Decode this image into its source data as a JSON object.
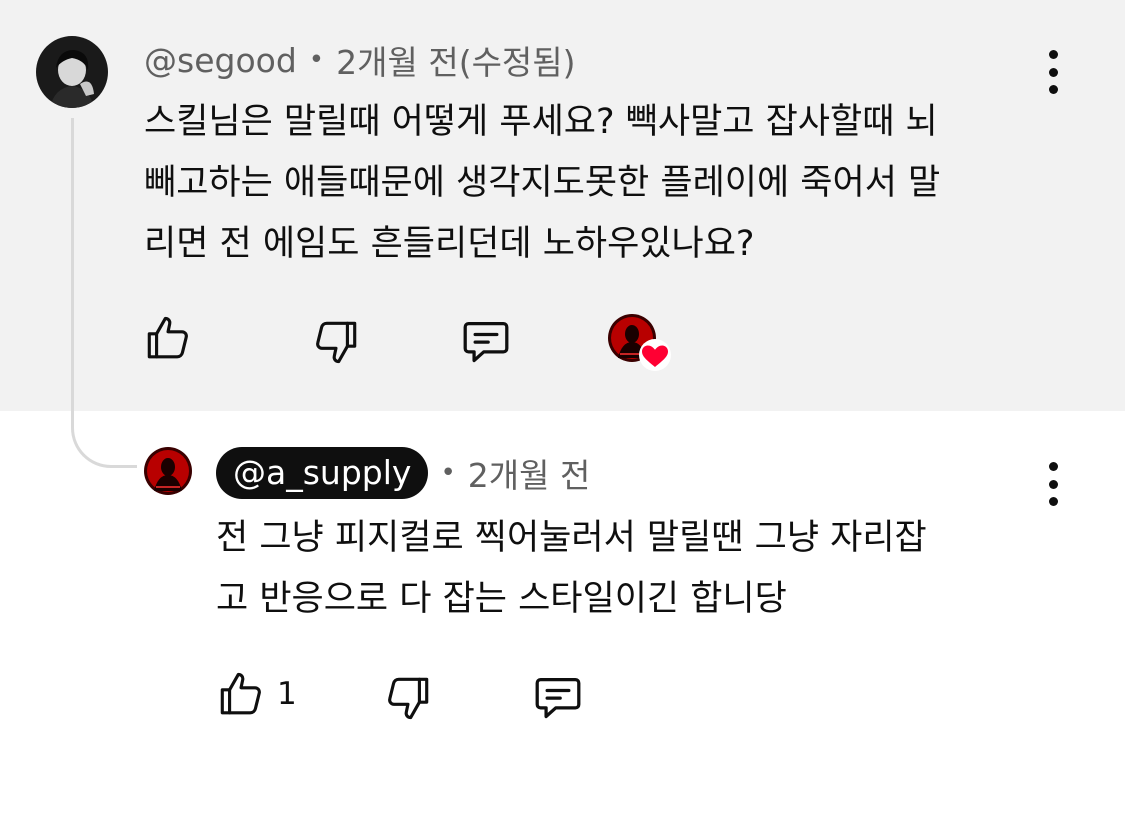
{
  "comment": {
    "author": "@segood",
    "time": "2개월 전(수정됨)",
    "text": "스킬님은 말릴때 어떻게 푸세요? 빽사말고 잡사할때 뇌\n빼고하는 애들때문에 생각지도못한 플레이에 죽어서 말\n리면 전 에임도 흔들리던데 노하우있나요?",
    "like_count": "",
    "creator_heart": true
  },
  "reply": {
    "author": "@a_supply",
    "time": "2개월 전",
    "text": "전 그냥 피지컬로 찍어눌러서 말릴땐 그냥 자리잡\n고 반응으로 다 잡는 스타일이긴 합니당",
    "like_count": "1"
  },
  "separator": "•",
  "icons": {
    "like": "thumbs-up-icon",
    "dislike": "thumbs-down-icon",
    "reply": "reply-comment-icon",
    "more": "more-vert-icon",
    "heart": "heart-icon"
  },
  "colors": {
    "parent_bg": "#f2f2f2",
    "meta_text": "#606060",
    "heart": "#ff0033",
    "pill_bg": "#0f0f0f"
  }
}
